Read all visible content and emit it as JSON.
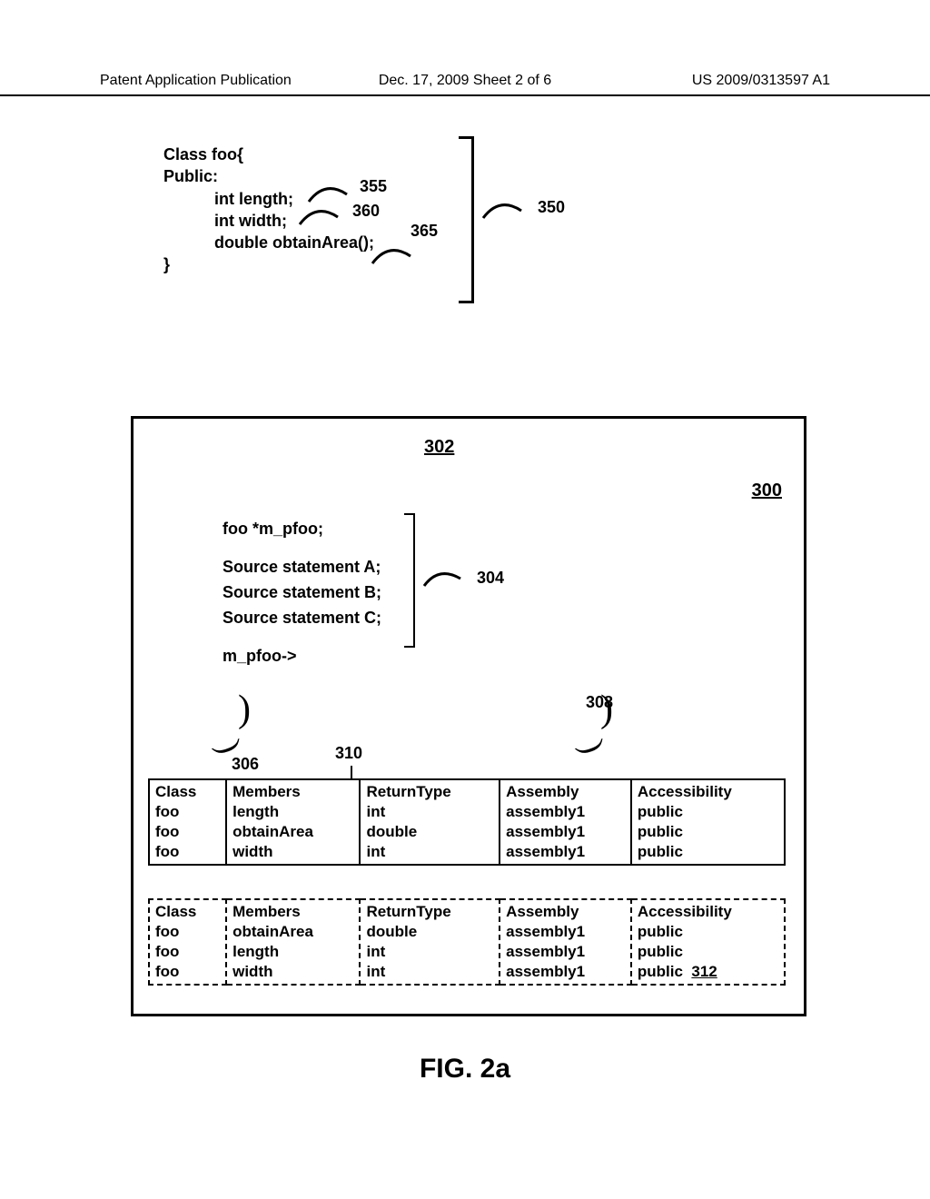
{
  "header": {
    "left": "Patent Application Publication",
    "mid": "Dec. 17, 2009  Sheet 2 of 6",
    "right": "US 2009/0313597 A1"
  },
  "code350": {
    "l1": "Class foo{",
    "l2": "Public:",
    "l3a": "int length;",
    "l3b": "int width;",
    "l3c": "double obtainArea();",
    "l4": "}"
  },
  "refs": {
    "r355": "355",
    "r360": "360",
    "r365": "365",
    "r350": "350",
    "r302": "302",
    "r300": "300",
    "r304": "304",
    "r306": "306",
    "r310": "310",
    "r308": "308",
    "r312": "312"
  },
  "code304": {
    "l1": "foo *m_pfoo;",
    "l2": "Source statement A;",
    "l3": "Source statement B;",
    "l4": "Source statement C;",
    "l5": "m_pfoo->"
  },
  "tables": {
    "headers": [
      "Class",
      "Members",
      "ReturnType",
      "Assembly",
      "Accessibility"
    ],
    "t1": [
      [
        "foo",
        "length",
        "int",
        "assembly1",
        "public"
      ],
      [
        "foo",
        "obtainArea",
        "double",
        "assembly1",
        "public"
      ],
      [
        "foo",
        "width",
        "int",
        "assembly1",
        "public"
      ]
    ],
    "t2": [
      [
        "foo",
        "obtainArea",
        "double",
        "assembly1",
        "public"
      ],
      [
        "foo",
        "length",
        "int",
        "assembly1",
        "public"
      ],
      [
        "foo",
        "width",
        "int",
        "assembly1",
        "public"
      ]
    ]
  },
  "caption": "FIG. 2a"
}
